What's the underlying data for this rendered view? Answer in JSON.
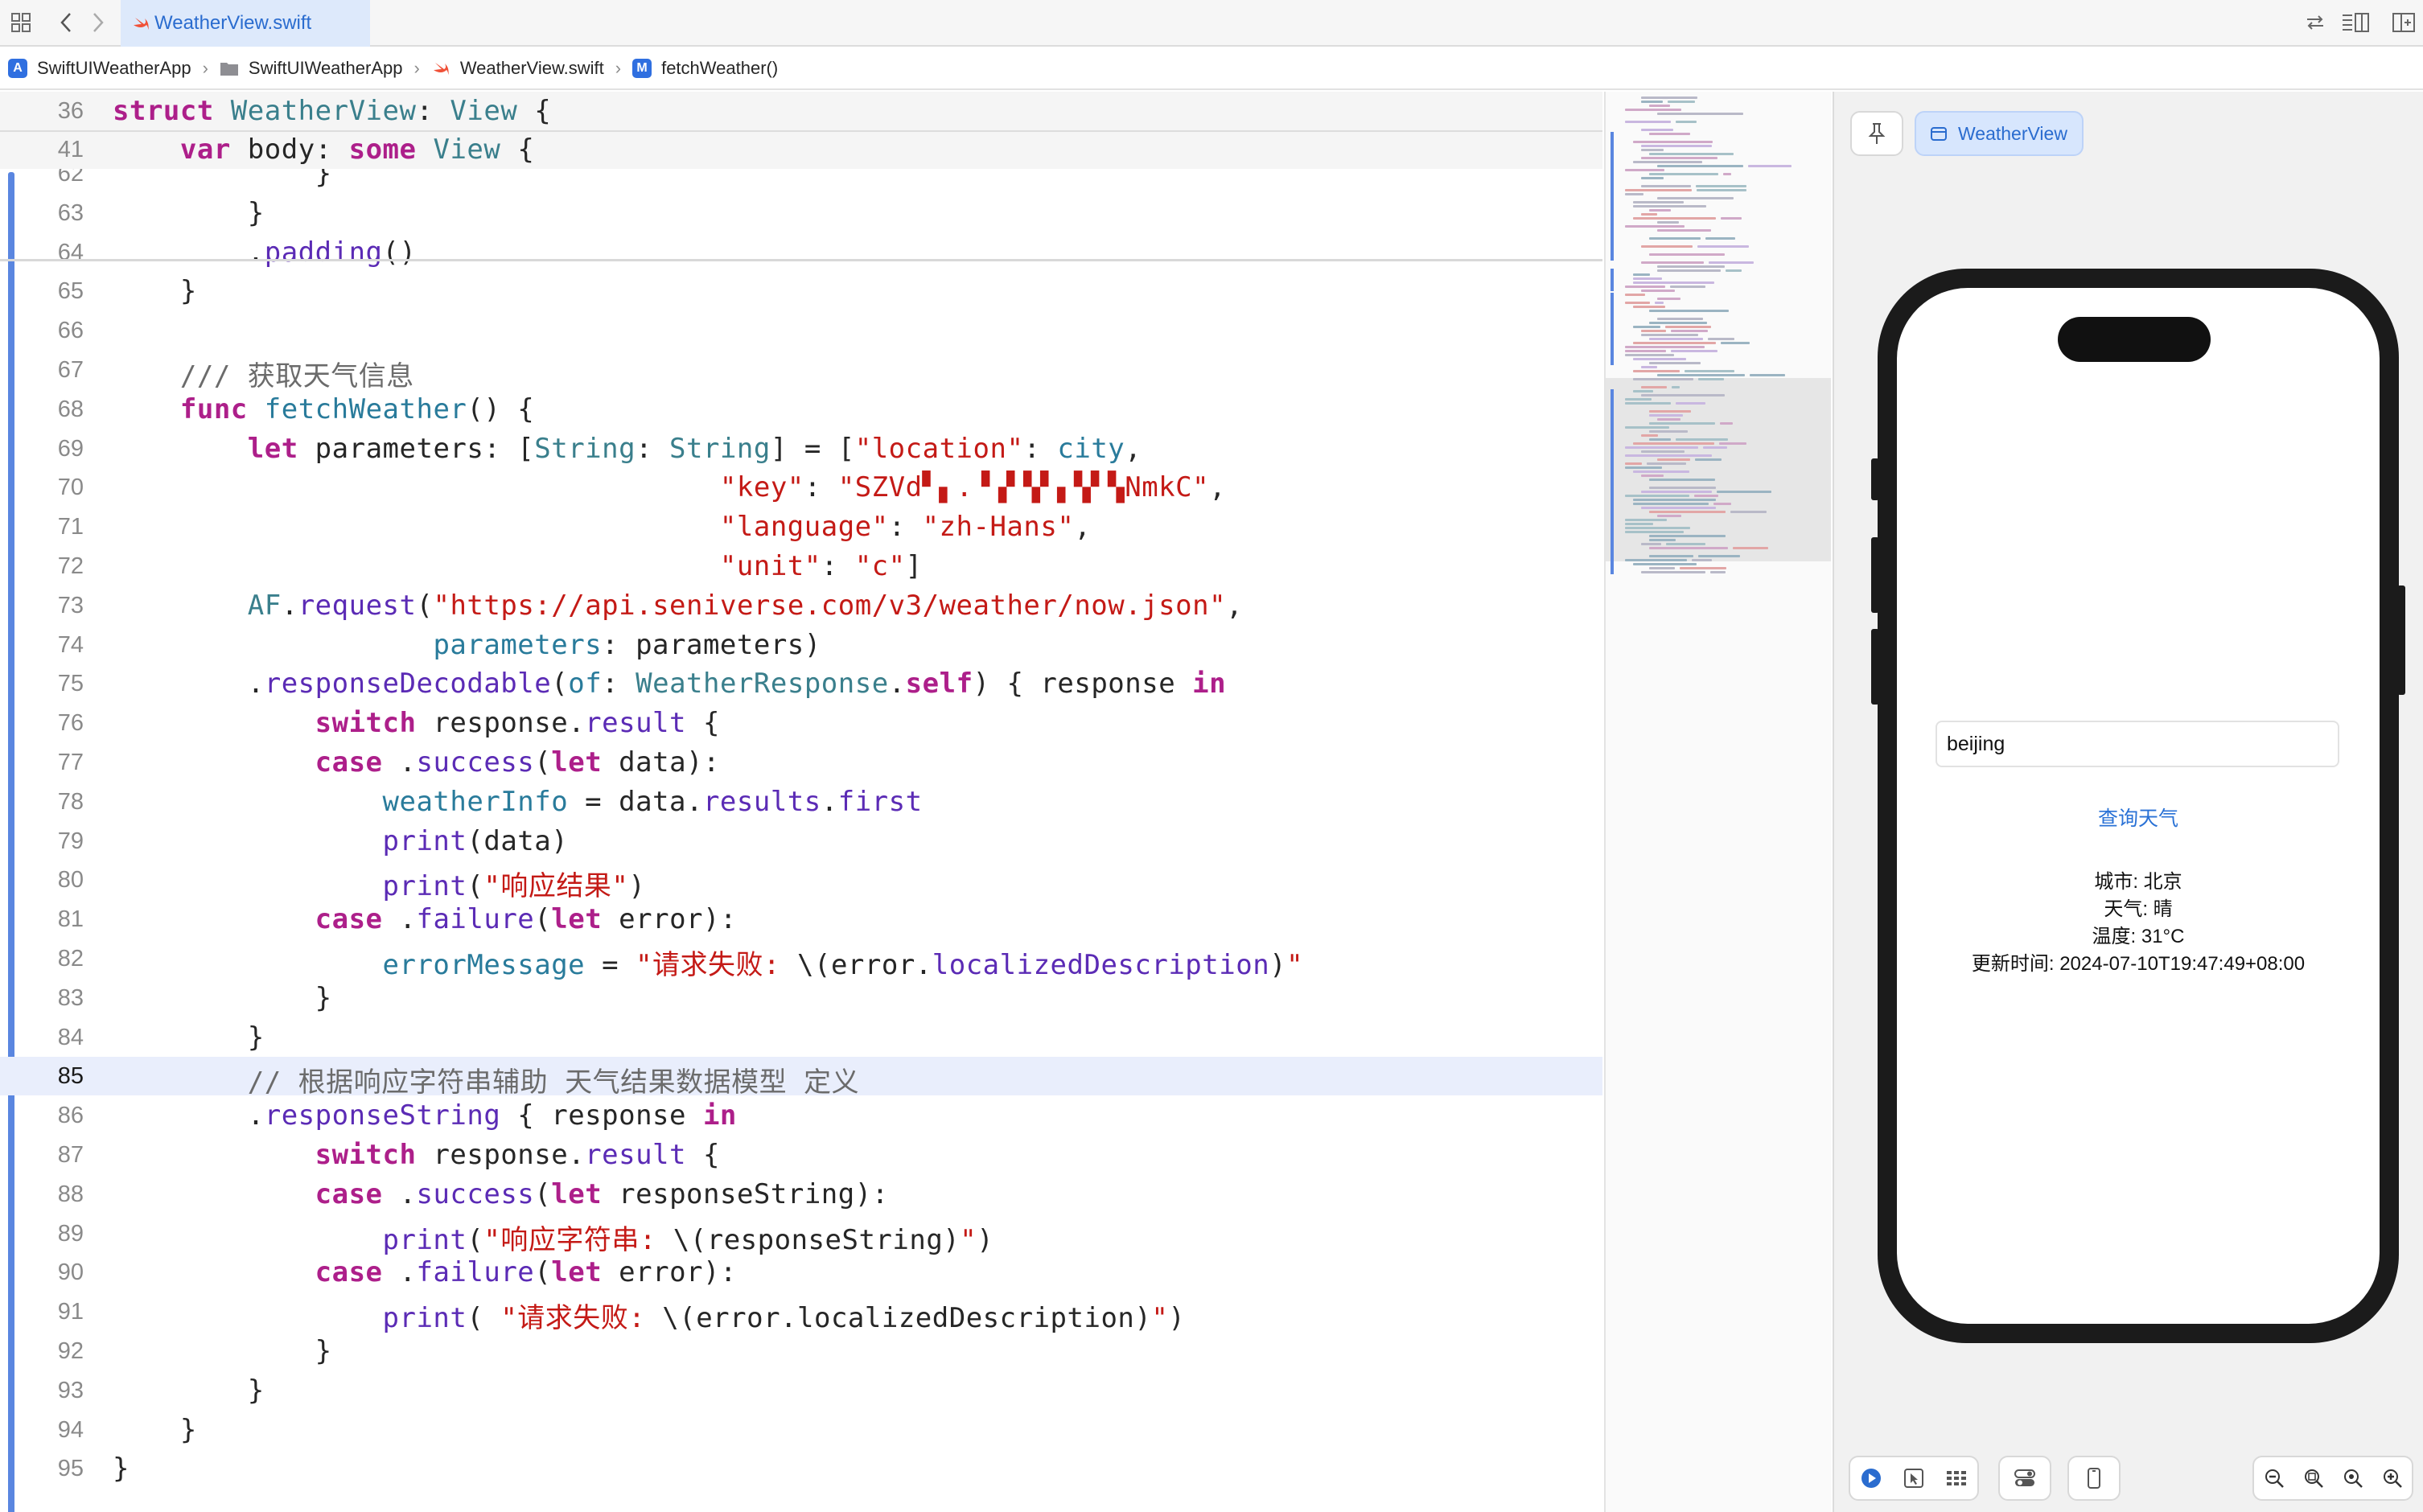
{
  "toolbar": {
    "tab_title": "WeatherView.swift"
  },
  "breadcrumb": [
    {
      "label": "SwiftUIWeatherApp",
      "icon": "app-icon"
    },
    {
      "label": "SwiftUIWeatherApp",
      "icon": "folder-icon"
    },
    {
      "label": "WeatherView.swift",
      "icon": "swift-file-icon"
    },
    {
      "label": "fetchWeather()",
      "icon": "method-icon",
      "icon_letter": "M"
    }
  ],
  "sticky_lines": [
    {
      "num": "36",
      "tokens": [
        [
          "kw",
          "struct"
        ],
        [
          "",
          ""
        ],
        [
          "ty",
          " WeatherView"
        ],
        [
          "",
          ": "
        ],
        [
          "ty",
          "View"
        ],
        [
          "",
          " {"
        ]
      ]
    },
    {
      "num": "41",
      "tokens": [
        [
          "",
          "    "
        ],
        [
          "kw",
          "var"
        ],
        [
          "",
          " body: "
        ],
        [
          "kw",
          "some"
        ],
        [
          "ty",
          " View"
        ],
        [
          "",
          " {"
        ]
      ]
    }
  ],
  "code_lines": [
    {
      "num": "62",
      "tokens": [
        [
          "",
          "            }"
        ]
      ]
    },
    {
      "num": "63",
      "tokens": [
        [
          "",
          "        }"
        ]
      ]
    },
    {
      "num": "64",
      "tokens": [
        [
          "",
          "        ."
        ],
        [
          "fn",
          "padding"
        ],
        [
          "",
          "()"
        ]
      ]
    },
    {
      "num": "65",
      "tokens": [
        [
          "",
          "    }"
        ]
      ]
    },
    {
      "num": "66",
      "tokens": [
        [
          "",
          ""
        ]
      ]
    },
    {
      "num": "67",
      "tokens": [
        [
          "cm",
          "    /// 获取天气信息"
        ]
      ]
    },
    {
      "num": "68",
      "tokens": [
        [
          "",
          "    "
        ],
        [
          "kw",
          "func"
        ],
        [
          "",
          ""
        ],
        [
          "pm",
          " fetchWeather"
        ],
        [
          "",
          "() {"
        ]
      ]
    },
    {
      "num": "69",
      "tokens": [
        [
          "",
          "        "
        ],
        [
          "kw",
          "let"
        ],
        [
          "",
          " parameters: ["
        ],
        [
          "ty",
          "String"
        ],
        [
          "",
          ": "
        ],
        [
          "ty",
          "String"
        ],
        [
          "",
          "] = ["
        ],
        [
          "str",
          "\"location\""
        ],
        [
          "",
          ": "
        ],
        [
          "pm",
          "city"
        ],
        [
          "",
          ","
        ]
      ]
    },
    {
      "num": "70",
      "tokens": [
        [
          "",
          "                                    "
        ],
        [
          "str",
          "\"key\""
        ],
        [
          "",
          ": "
        ],
        [
          "str",
          "\"SZVd▘▖.▝▗▘▚▘▖▚▘▚NmkC\""
        ],
        [
          "",
          ","
        ]
      ]
    },
    {
      "num": "71",
      "tokens": [
        [
          "",
          "                                    "
        ],
        [
          "str",
          "\"language\""
        ],
        [
          "",
          ": "
        ],
        [
          "str",
          "\"zh-Hans\""
        ],
        [
          "",
          ","
        ]
      ]
    },
    {
      "num": "72",
      "tokens": [
        [
          "",
          "                                    "
        ],
        [
          "str",
          "\"unit\""
        ],
        [
          "",
          ": "
        ],
        [
          "str",
          "\"c\""
        ],
        [
          "",
          "]"
        ]
      ]
    },
    {
      "num": "73",
      "tokens": [
        [
          "",
          "        "
        ],
        [
          "ty",
          "AF"
        ],
        [
          "",
          "."
        ],
        [
          "fn",
          "request"
        ],
        [
          "",
          "("
        ],
        [
          "str",
          "\"https://api.seniverse.com/v3/weather/now.json\""
        ],
        [
          "",
          ","
        ]
      ]
    },
    {
      "num": "74",
      "tokens": [
        [
          "",
          "                   "
        ],
        [
          "pm",
          "parameters"
        ],
        [
          "",
          ": parameters)"
        ]
      ]
    },
    {
      "num": "75",
      "tokens": [
        [
          "",
          "        ."
        ],
        [
          "fn",
          "responseDecodable"
        ],
        [
          "",
          "("
        ],
        [
          "pm",
          "of"
        ],
        [
          "",
          ": "
        ],
        [
          "ty",
          "WeatherResponse"
        ],
        [
          "",
          "."
        ],
        [
          "kw",
          "self"
        ],
        [
          "",
          ") { response "
        ],
        [
          "kw",
          "in"
        ]
      ]
    },
    {
      "num": "76",
      "tokens": [
        [
          "",
          "            "
        ],
        [
          "kw",
          "switch"
        ],
        [
          "",
          " response."
        ],
        [
          "fn",
          "result"
        ],
        [
          "",
          " {"
        ]
      ]
    },
    {
      "num": "77",
      "tokens": [
        [
          "",
          "            "
        ],
        [
          "kw",
          "case"
        ],
        [
          "",
          " ."
        ],
        [
          "fn",
          "success"
        ],
        [
          "",
          "("
        ],
        [
          "kw",
          "let"
        ],
        [
          "",
          " data):"
        ]
      ]
    },
    {
      "num": "78",
      "tokens": [
        [
          "",
          "                "
        ],
        [
          "pm",
          "weatherInfo"
        ],
        [
          "",
          " = data."
        ],
        [
          "fn",
          "results"
        ],
        [
          "",
          "."
        ],
        [
          "fn",
          "first"
        ]
      ]
    },
    {
      "num": "79",
      "tokens": [
        [
          "",
          "                "
        ],
        [
          "fn",
          "print"
        ],
        [
          "",
          "(data)"
        ]
      ]
    },
    {
      "num": "80",
      "tokens": [
        [
          "",
          "                "
        ],
        [
          "fn",
          "print"
        ],
        [
          "",
          "("
        ],
        [
          "str",
          "\"响应结果\""
        ],
        [
          "",
          ")"
        ]
      ]
    },
    {
      "num": "81",
      "tokens": [
        [
          "",
          "            "
        ],
        [
          "kw",
          "case"
        ],
        [
          "",
          " ."
        ],
        [
          "fn",
          "failure"
        ],
        [
          "",
          "("
        ],
        [
          "kw",
          "let"
        ],
        [
          "",
          " error):"
        ]
      ]
    },
    {
      "num": "82",
      "tokens": [
        [
          "",
          "                "
        ],
        [
          "pm",
          "errorMessage"
        ],
        [
          "",
          " = "
        ],
        [
          "str",
          "\"请求失败: "
        ],
        [
          "",
          "\\(error."
        ],
        [
          "fn",
          "localizedDescription"
        ],
        [
          "",
          ")"
        ],
        [
          "str",
          "\""
        ]
      ]
    },
    {
      "num": "83",
      "tokens": [
        [
          "",
          "            }"
        ]
      ]
    },
    {
      "num": "84",
      "tokens": [
        [
          "",
          "        }"
        ]
      ]
    },
    {
      "num": "85",
      "tokens": [
        [
          "cm",
          "        // 根据响应字符串辅助 天气结果数据模型 定义"
        ]
      ],
      "current": true
    },
    {
      "num": "86",
      "tokens": [
        [
          "",
          "        ."
        ],
        [
          "fn",
          "responseString"
        ],
        [
          "",
          " { response "
        ],
        [
          "kw",
          "in"
        ]
      ]
    },
    {
      "num": "87",
      "tokens": [
        [
          "",
          "            "
        ],
        [
          "kw",
          "switch"
        ],
        [
          "",
          " response."
        ],
        [
          "fn",
          "result"
        ],
        [
          "",
          " {"
        ]
      ]
    },
    {
      "num": "88",
      "tokens": [
        [
          "",
          "            "
        ],
        [
          "kw",
          "case"
        ],
        [
          "",
          " ."
        ],
        [
          "fn",
          "success"
        ],
        [
          "",
          "("
        ],
        [
          "kw",
          "let"
        ],
        [
          "",
          " responseString):"
        ]
      ]
    },
    {
      "num": "89",
      "tokens": [
        [
          "",
          "                "
        ],
        [
          "fn",
          "print"
        ],
        [
          "",
          "("
        ],
        [
          "str",
          "\"响应字符串: "
        ],
        [
          "",
          "\\(responseString)"
        ],
        [
          "str",
          "\""
        ],
        [
          "",
          ")"
        ]
      ]
    },
    {
      "num": "90",
      "tokens": [
        [
          "",
          "            "
        ],
        [
          "kw",
          "case"
        ],
        [
          "",
          " ."
        ],
        [
          "fn",
          "failure"
        ],
        [
          "",
          "("
        ],
        [
          "kw",
          "let"
        ],
        [
          "",
          " error):"
        ]
      ]
    },
    {
      "num": "91",
      "tokens": [
        [
          "",
          "                "
        ],
        [
          "fn",
          "print"
        ],
        [
          "",
          "( "
        ],
        [
          "str",
          "\"请求失败: "
        ],
        [
          "",
          "\\(error.localizedDescription)"
        ],
        [
          "str",
          "\""
        ],
        [
          "",
          ")"
        ]
      ]
    },
    {
      "num": "92",
      "tokens": [
        [
          "",
          "            }"
        ]
      ]
    },
    {
      "num": "93",
      "tokens": [
        [
          "",
          "        }"
        ]
      ]
    },
    {
      "num": "94",
      "tokens": [
        [
          "",
          "    }"
        ]
      ]
    },
    {
      "num": "95",
      "tokens": [
        [
          "",
          "}"
        ]
      ]
    }
  ],
  "preview": {
    "view_button": "WeatherView",
    "input_value": "beijing",
    "query_button": "查询天气",
    "info_lines": [
      "城市: 北京",
      "天气: 晴",
      "温度: 31°C",
      "更新时间: 2024-07-10T19:47:49+08:00"
    ]
  },
  "colors": {
    "keyword": "#ad1f8a",
    "type": "#3a7f8c",
    "function": "#5b2bb5",
    "string": "#c41a16",
    "comment": "#6b6b6b",
    "accent": "#2a6ccf"
  }
}
